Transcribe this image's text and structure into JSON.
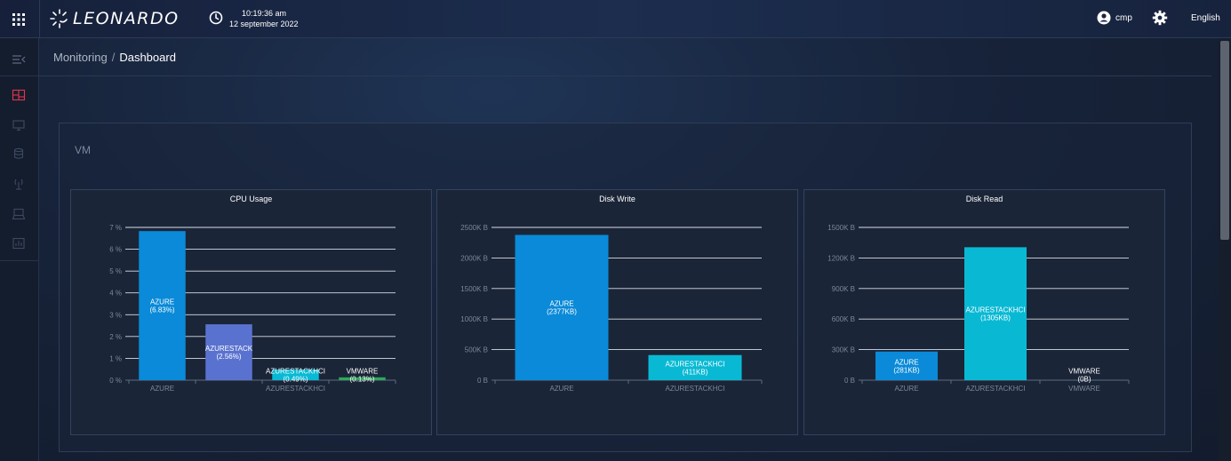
{
  "header": {
    "logo_text": "LEONARDO",
    "time": "10:19:36 am",
    "date": "12 september 2022",
    "user": "cmp",
    "language": "English"
  },
  "sidebar": {
    "items": [
      {
        "icon": "collapse-menu-icon",
        "active": false
      },
      {
        "icon": "dashboard-icon",
        "active": true
      },
      {
        "icon": "monitor-icon",
        "active": false
      },
      {
        "icon": "database-icon",
        "active": false
      },
      {
        "icon": "antenna-icon",
        "active": false
      },
      {
        "icon": "computer-icon",
        "active": false
      },
      {
        "icon": "report-icon",
        "active": false
      }
    ]
  },
  "breadcrumb": {
    "parent": "Monitoring",
    "separator": "/",
    "current": "Dashboard"
  },
  "section": {
    "title": "VM"
  },
  "colors": {
    "azure": "#0a8ad8",
    "azurestack": "#5a72cf",
    "azurestackhci": "#09b9d4",
    "vmware": "#2fa85a",
    "accent_active": "#e0364b"
  },
  "chart_data": [
    {
      "type": "bar",
      "title": "CPU Usage",
      "categories": [
        "AZURE",
        "AZURESTACK",
        "AZURESTACKHCI",
        "VMWARE"
      ],
      "x_tick_labels": [
        "AZURE",
        "",
        "AZURESTACKHCI",
        ""
      ],
      "values": [
        6.83,
        2.56,
        0.49,
        0.13
      ],
      "bar_labels": [
        "AZURE\n(6.83%)",
        "AZURESTACK\n(2.56%)",
        "AZURESTACKHCI\n(0.49%)",
        "VMWARE\n(0.13%)"
      ],
      "colors": [
        "#0a8ad8",
        "#5a72cf",
        "#09b9d4",
        "#2fa85a"
      ],
      "yticks": [
        0,
        1,
        2,
        3,
        4,
        5,
        6,
        7
      ],
      "ytick_labels": [
        "0 %",
        "1 %",
        "2 %",
        "3 %",
        "4 %",
        "5 %",
        "6 %",
        "7 %"
      ],
      "ylim": [
        0,
        7
      ],
      "grid": true
    },
    {
      "type": "bar",
      "title": "Disk Write",
      "categories": [
        "AZURE",
        "AZURESTACKHCI"
      ],
      "x_tick_labels": [
        "AZURE",
        "AZURESTACKHCI"
      ],
      "values": [
        2377,
        411
      ],
      "bar_labels": [
        "AZURE\n(2377KB)",
        "AZURESTACKHCI\n(411KB)"
      ],
      "colors": [
        "#0a8ad8",
        "#09b9d4"
      ],
      "yticks": [
        0,
        500,
        1000,
        1500,
        2000,
        2500
      ],
      "ytick_labels": [
        "0 B",
        "500K B",
        "1000K B",
        "1500K B",
        "2000K B",
        "2500K B"
      ],
      "ylim": [
        0,
        2500
      ],
      "grid": true
    },
    {
      "type": "bar",
      "title": "Disk Read",
      "categories": [
        "AZURE",
        "AZURESTACKHCI",
        "VMWARE"
      ],
      "x_tick_labels": [
        "AZURE",
        "AZURESTACKHCI",
        "VMWARE"
      ],
      "values": [
        281,
        1305,
        0
      ],
      "bar_labels": [
        "AZURE\n(281KB)",
        "AZURESTACKHCI\n(1305KB)",
        "VMWARE\n(0B)"
      ],
      "colors": [
        "#0a8ad8",
        "#09b9d4",
        "#2fa85a"
      ],
      "yticks": [
        0,
        300,
        600,
        900,
        1200,
        1500
      ],
      "ytick_labels": [
        "0 B",
        "300K B",
        "600K B",
        "900K B",
        "1200K B",
        "1500K B"
      ],
      "ylim": [
        0,
        1500
      ],
      "grid": true
    }
  ]
}
